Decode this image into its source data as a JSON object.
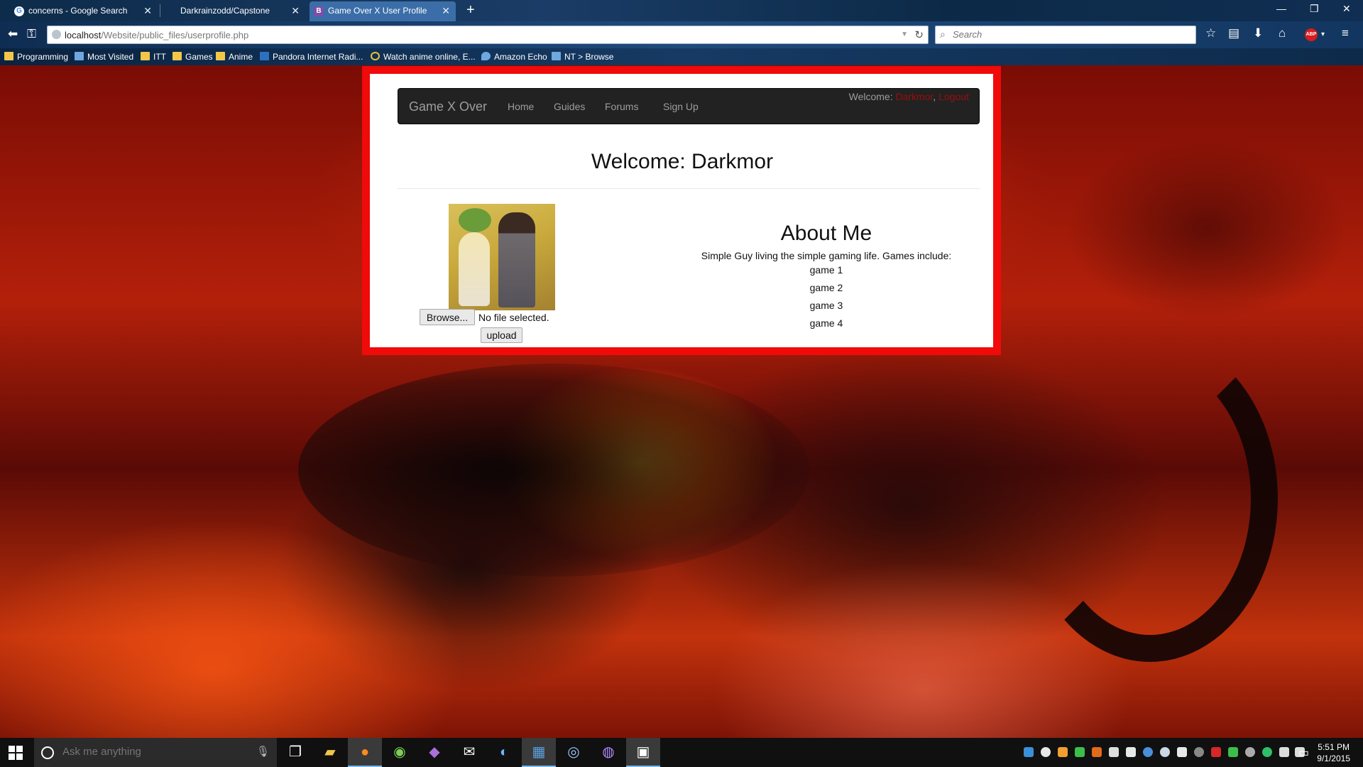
{
  "browser": {
    "tabs": [
      {
        "label": "concerns - Google Search",
        "active": false
      },
      {
        "label": "Darkrainzodd/Capstone",
        "active": false
      },
      {
        "label": "Game Over X User Profile",
        "active": true
      }
    ],
    "new_tab": "+",
    "url_host": "localhost",
    "url_path": "/Website/public_files/userprofile.php",
    "search_placeholder": "Search",
    "adblock_label": "ABP",
    "bookmarks": [
      {
        "label": "Programming",
        "icon": "folder-icon"
      },
      {
        "label": "Most Visited",
        "icon": "page-icon"
      },
      {
        "label": "ITT",
        "icon": "folder-icon"
      },
      {
        "label": "Games",
        "icon": "folder-icon"
      },
      {
        "label": "Anime",
        "icon": "folder-icon"
      },
      {
        "label": "Pandora Internet Radi...",
        "icon": "pandora-icon"
      },
      {
        "label": "Watch anime online, E...",
        "icon": "site-icon"
      },
      {
        "label": "Amazon Echo",
        "icon": "location-icon"
      },
      {
        "label": "NT > Browse",
        "icon": "page-icon"
      }
    ]
  },
  "site": {
    "brand": "Game X Over",
    "nav": [
      "Home",
      "Guides",
      "Forums",
      "Sign Up"
    ],
    "welcome_prefix": "Welcome: ",
    "welcome_user": "Darkmor",
    "welcome_sep": ", ",
    "logout": "Logout",
    "page_title": "Welcome: Darkmor",
    "browse_button": "Browse...",
    "no_file_text": "No file selected.",
    "upload_button": "upload",
    "about_title": "About Me",
    "about_text": "Simple Guy living the simple gaming life. Games include:",
    "games": [
      "game 1",
      "game 2",
      "game 3",
      "game 4"
    ]
  },
  "taskbar": {
    "search_placeholder": "Ask me anything",
    "time": "5:51 PM",
    "date": "9/1/2015"
  },
  "colors": {
    "panel_border": "#f00a0a",
    "navbar_bg": "#222222",
    "welcome_user_color": "#9b0d0d"
  }
}
